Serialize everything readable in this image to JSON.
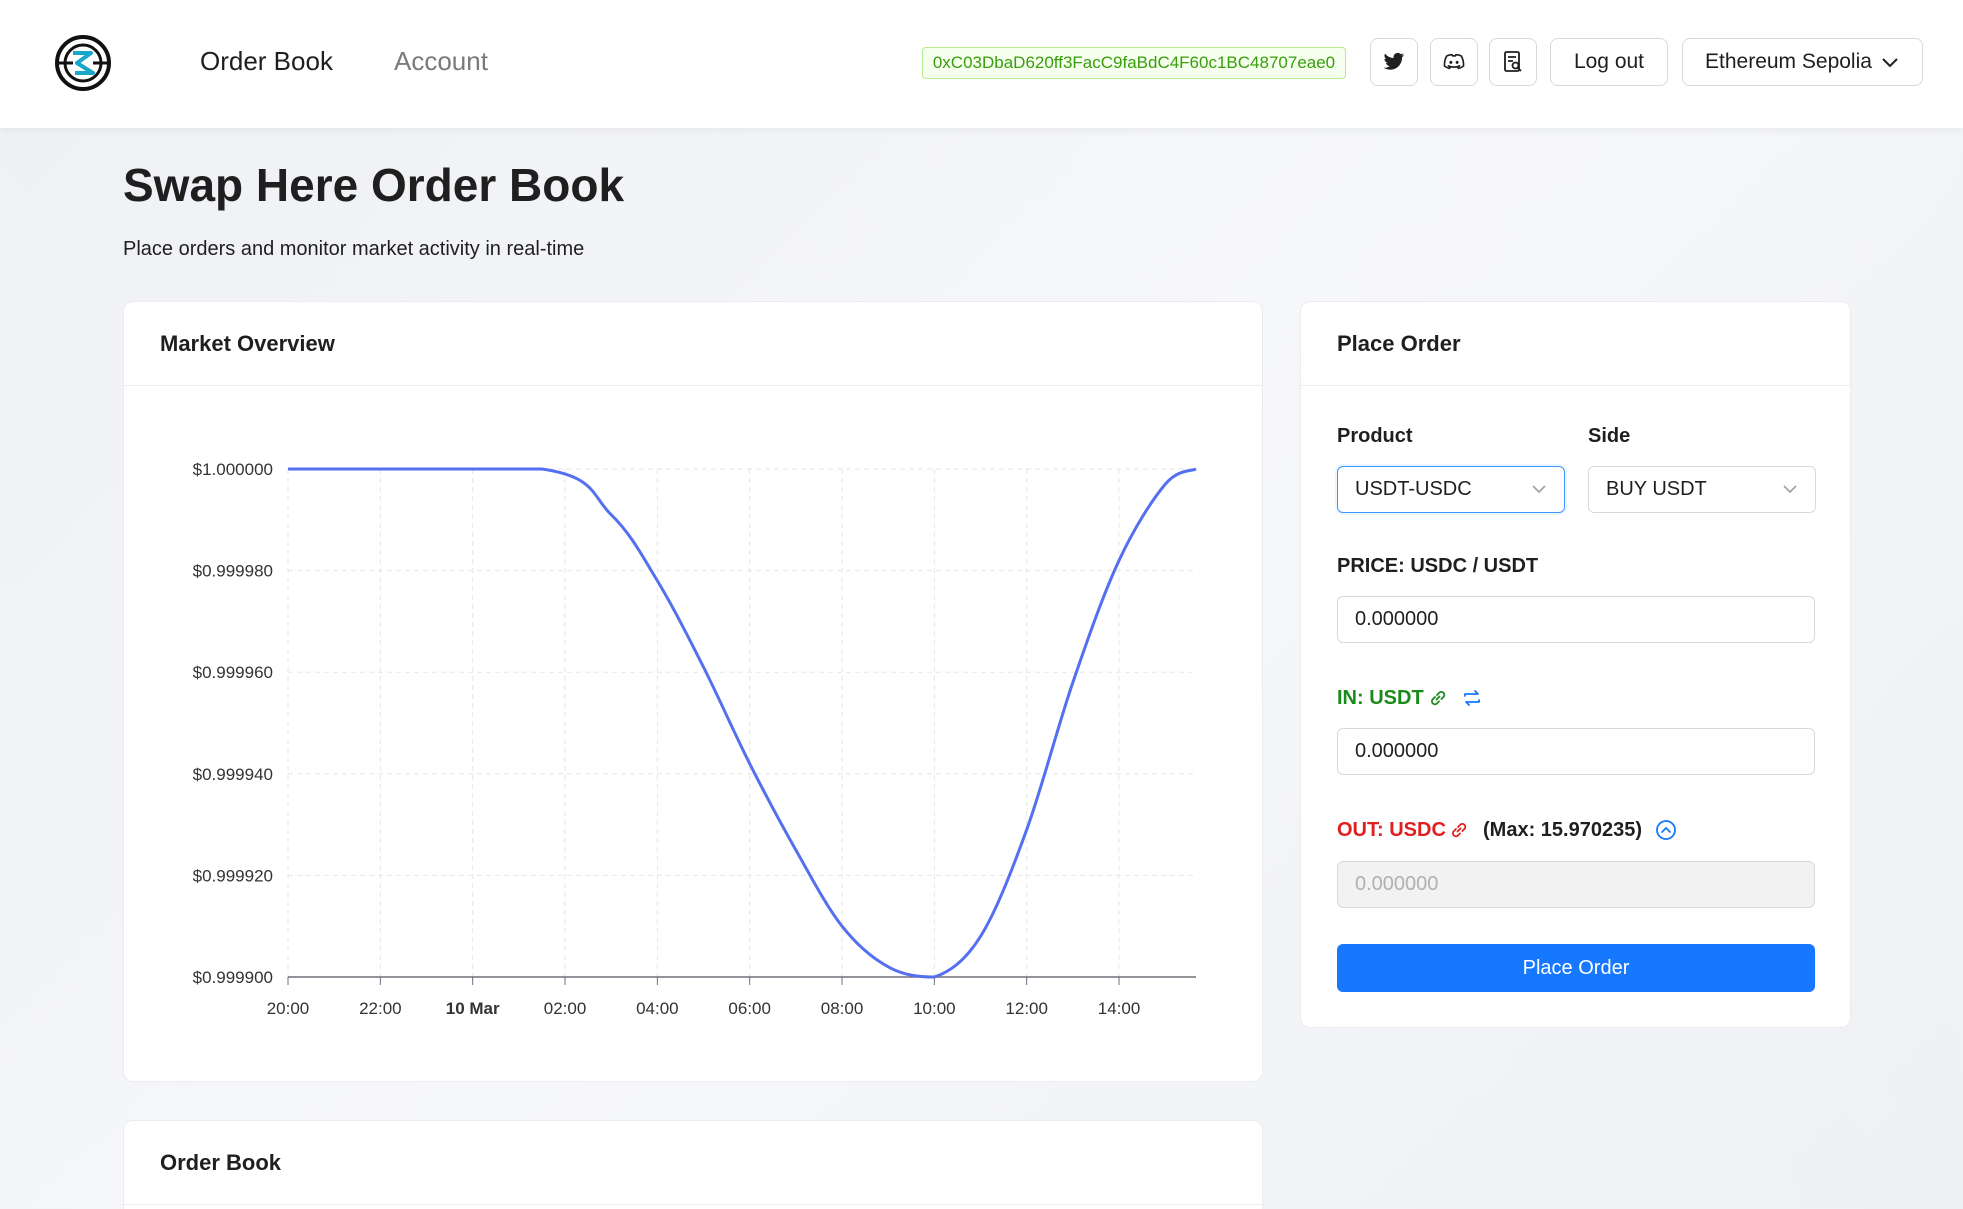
{
  "header": {
    "nav": {
      "order_book": "Order Book",
      "account": "Account"
    },
    "wallet_address": "0xC03DbaD620ff3FacC9faBdC4F60c1BC48707eae0",
    "logout_label": "Log out",
    "network": "Ethereum Sepolia",
    "icons": [
      "logo-icon",
      "twitter-icon",
      "discord-icon",
      "docs-icon",
      "chevron-down-icon"
    ]
  },
  "page": {
    "title": "Swap Here Order Book",
    "subtitle": "Place orders and monitor market activity in real-time"
  },
  "market": {
    "title": "Market Overview"
  },
  "chart_data": {
    "type": "line",
    "x": [
      "20:00",
      "22:00",
      "10 Mar",
      "02:00",
      "04:00",
      "06:00",
      "08:00",
      "10:00",
      "12:00",
      "14:00"
    ],
    "x_bold": [
      "10 Mar"
    ],
    "y_ticks": [
      "$1.000000",
      "$0.999980",
      "$0.999960",
      "$0.999940",
      "$0.999920",
      "$0.999900"
    ],
    "ylim": [
      0.9999,
      1.0
    ],
    "series": [
      {
        "color": "#5470f0",
        "points": [
          [
            "20:00",
            1.0
          ],
          [
            "01:30",
            1.0
          ],
          [
            "03:00",
            0.999991
          ],
          [
            "04:00",
            0.999978
          ],
          [
            "05:00",
            0.999961
          ],
          [
            "06:00",
            0.999942
          ],
          [
            "07:00",
            0.999925
          ],
          [
            "08:00",
            0.99991
          ],
          [
            "09:00",
            0.999902
          ],
          [
            "10:00",
            0.9999
          ],
          [
            "11:00",
            0.999908
          ],
          [
            "12:00",
            0.999929
          ],
          [
            "13:00",
            0.999958
          ],
          [
            "14:00",
            0.999982
          ],
          [
            "15:00",
            0.999997
          ],
          [
            "15:40",
            1.0
          ]
        ]
      }
    ],
    "grid": true
  },
  "order": {
    "title": "Place Order",
    "product_label": "Product",
    "product_value": "USDT-USDC",
    "side_label": "Side",
    "side_value": "BUY USDT",
    "price_label": "PRICE: USDC / USDT",
    "price_value": "0.000000",
    "in_label": "IN: USDT",
    "in_value": "0.000000",
    "out_label": "OUT: USDC",
    "max_text": "(Max: 15.970235)",
    "out_value": "0.000000",
    "submit_label": "Place Order",
    "colors": {
      "in": "#1a8a1a",
      "out": "#e02020",
      "primary": "#1677ff"
    }
  },
  "order_book": {
    "title": "Order Book"
  }
}
